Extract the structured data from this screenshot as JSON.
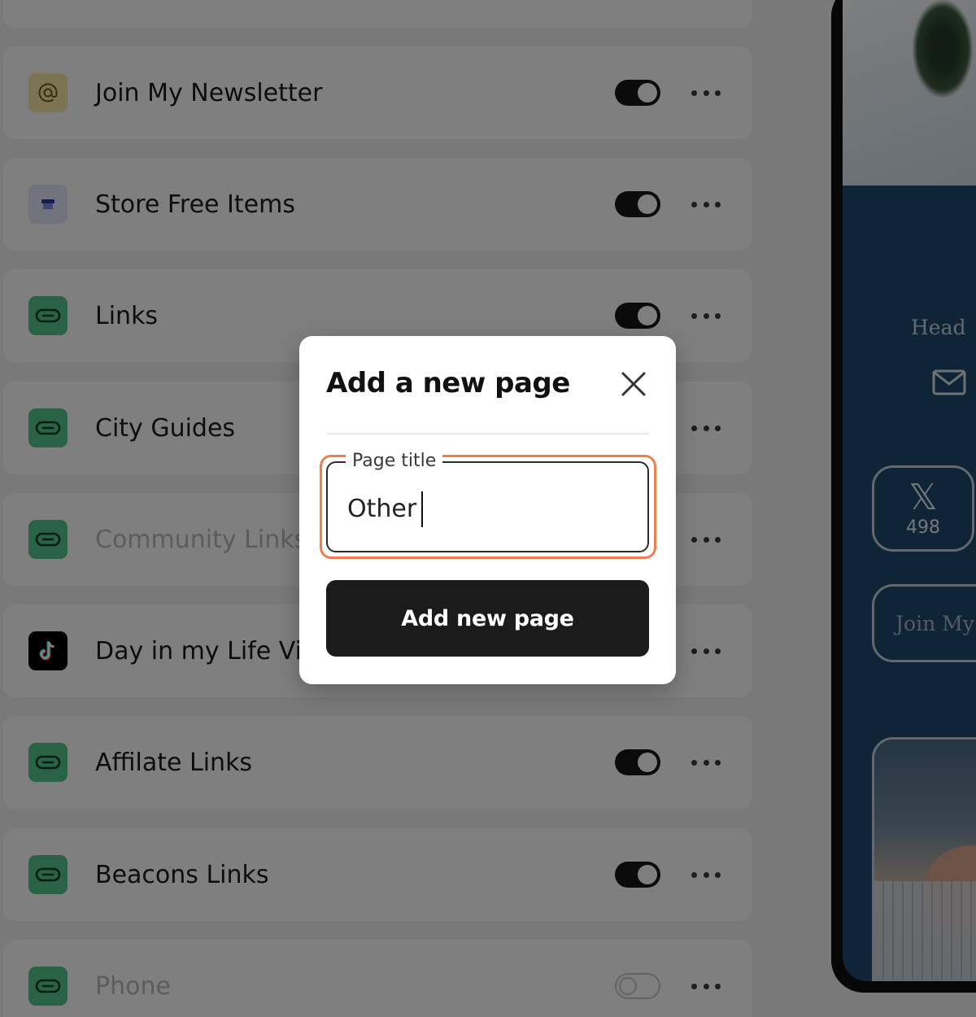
{
  "list": {
    "rows": [
      {
        "label": "Join My Newsletter",
        "icon": "at-sign-icon",
        "icon_bg": "#f6e8a6",
        "enabled": true
      },
      {
        "label": "Store Free Items",
        "icon": "store-icon",
        "icon_bg": "#e3e6fa",
        "enabled": true
      },
      {
        "label": "Links",
        "icon": "link-icon",
        "icon_bg": "#55c58a",
        "enabled": true
      },
      {
        "label": "City Guides",
        "icon": "link-icon",
        "icon_bg": "#55c58a",
        "enabled": true
      },
      {
        "label": "Community Links",
        "icon": "link-icon",
        "icon_bg": "#55c58a",
        "enabled": false
      },
      {
        "label": "Day in my Life Videos",
        "icon": "tiktok-icon",
        "icon_bg": "#000000",
        "enabled": true
      },
      {
        "label": "Affilate Links",
        "icon": "link-icon",
        "icon_bg": "#55c58a",
        "enabled": true
      },
      {
        "label": "Beacons Links",
        "icon": "link-icon",
        "icon_bg": "#55c58a",
        "enabled": true
      },
      {
        "label": "Phone",
        "icon": "link-icon",
        "icon_bg": "#55c58a",
        "enabled": false
      }
    ]
  },
  "preview": {
    "heading_fragment": "Head",
    "x_count": "498",
    "join_fragment": "Join My"
  },
  "modal": {
    "title": "Add a new page",
    "field_label": "Page title",
    "field_value": "Other",
    "submit_label": "Add new page"
  },
  "colors": {
    "highlight": "#f07d4e",
    "toggle_on": "#161616",
    "preview_bg": "#1f4a6f"
  }
}
